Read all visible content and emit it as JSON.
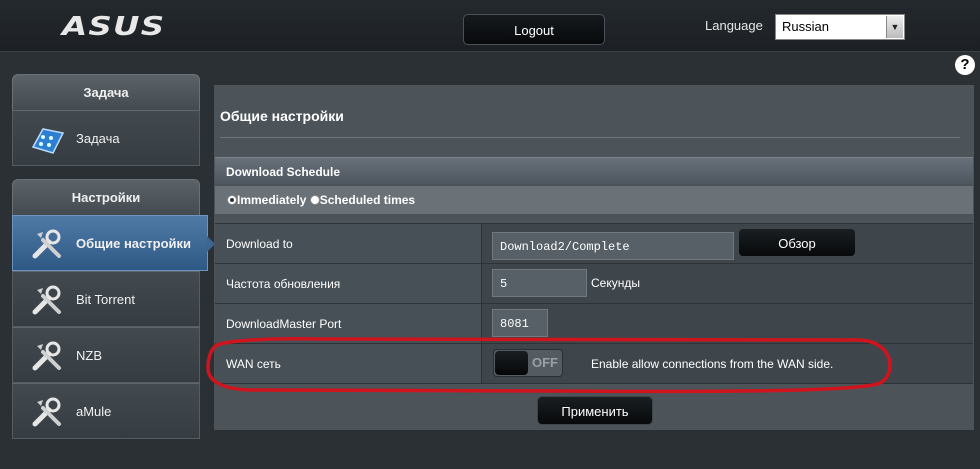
{
  "header": {
    "logo": "ASUS",
    "logout_label": "Logout",
    "language_label": "Language",
    "language_value": "Russian"
  },
  "sidebar": {
    "task_header": "Задача",
    "task_item": "Задача",
    "settings_header": "Настройки",
    "items": [
      {
        "label": "Общие настройки",
        "icon": "tools-icon",
        "active": true
      },
      {
        "label": "Bit Torrent",
        "icon": "tools-icon",
        "active": false
      },
      {
        "label": "NZB",
        "icon": "tools-icon",
        "active": false
      },
      {
        "label": "aMule",
        "icon": "tools-icon",
        "active": false
      }
    ]
  },
  "main": {
    "title": "Общие настройки",
    "section_title": "Download Schedule",
    "schedule_options": [
      {
        "label": "Immediately",
        "checked": true
      },
      {
        "label": "Scheduled times",
        "checked": false
      }
    ],
    "rows": {
      "download_to": {
        "label": "Download to",
        "value": "Download2/Complete",
        "browse_label": "Обзор"
      },
      "refresh": {
        "label": "Частота обновления",
        "value": "5",
        "unit": "Секунды"
      },
      "port": {
        "label": "DownloadMaster Port",
        "value": "8081"
      },
      "wan": {
        "label": "WAN сеть",
        "toggle": "OFF",
        "description": "Enable allow connections from the WAN side."
      }
    },
    "apply_label": "Применить"
  },
  "colors": {
    "accent_active": "#3c6591",
    "annotation": "#d0141e",
    "background": "#2b3035"
  }
}
